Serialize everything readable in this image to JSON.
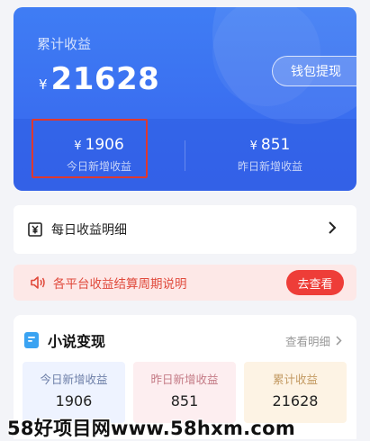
{
  "earnings": {
    "total_label": "累计收益",
    "currency": "¥",
    "total_amount": "21628",
    "withdraw_label": "钱包提现",
    "today_value": "1906",
    "today_label": "今日新增收益",
    "yesterday_value": "851",
    "yesterday_label": "昨日新增收益"
  },
  "daily_detail": {
    "label": "每日收益明细",
    "icon": "yen-receipt-icon"
  },
  "notice": {
    "text": "各平台收益结算周期说明",
    "button_label": "去查看",
    "icon": "speaker-icon"
  },
  "novel": {
    "title": "小说变现",
    "detail_link": "查看明细",
    "stats": [
      {
        "label": "今日新增收益",
        "value": "1906"
      },
      {
        "label": "昨日新增收益",
        "value": "851"
      },
      {
        "label": "累计收益",
        "value": "21628"
      }
    ]
  },
  "watermark": "58好项目网www.58hxm.com",
  "colors": {
    "card_blue": "#3f7df4",
    "notice_red": "#ee3d38",
    "highlight_red": "#e0382e"
  }
}
